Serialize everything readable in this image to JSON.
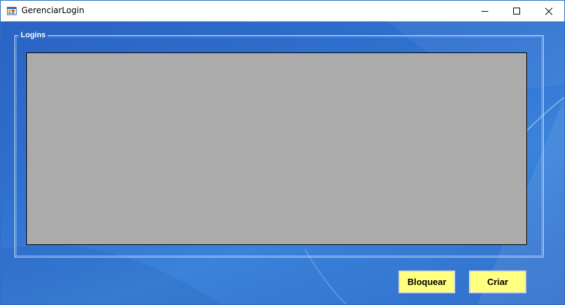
{
  "window": {
    "title": "GerenciarLogin",
    "controls": {
      "minimize": "minimize-icon",
      "maximize": "maximize-icon",
      "close": "close-icon"
    }
  },
  "groupbox": {
    "legend": "Logins"
  },
  "grid": {
    "rows": [],
    "background": "#ababab"
  },
  "actions": {
    "bloquear_label": "Bloquear",
    "criar_label": "Criar"
  },
  "colors": {
    "client_background": "#2f70cf",
    "button_background": "#ffff80",
    "titlebar": "#ffffff"
  }
}
